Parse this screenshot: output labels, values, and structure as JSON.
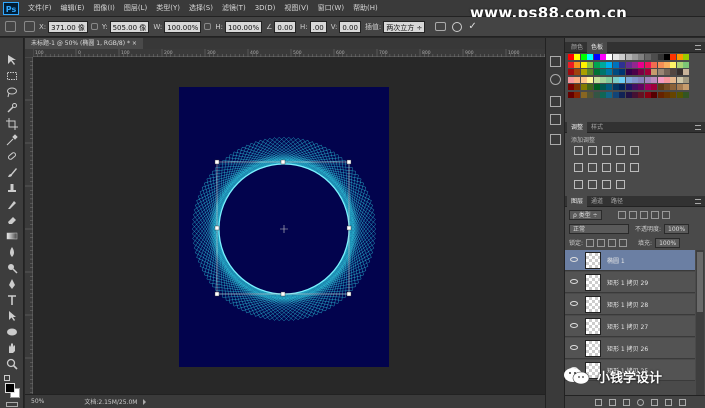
{
  "app": {
    "logo": "Ps",
    "watermark": "www.ps88.com.cn"
  },
  "menu": [
    "文件(F)",
    "编辑(E)",
    "图像(I)",
    "图层(L)",
    "类型(Y)",
    "选择(S)",
    "滤镜(T)",
    "3D(D)",
    "视图(V)",
    "窗口(W)",
    "帮助(H)"
  ],
  "options": {
    "x_label": "X:",
    "x_value": "371.00 像 ",
    "y_label": "Y:",
    "y_value": "505.00 像 ",
    "w_label": "W:",
    "w_value": "100.00%",
    "h_label": "H:",
    "h_value": "100.00%",
    "rot_label": "∠",
    "rot_value": "0.00",
    "hskew_label": "H:",
    "hskew_value": ".00",
    "vskew_label": "V:",
    "vskew_value": "0.00",
    "interp_label": "插值:",
    "interp_value": "两次立方 ÷"
  },
  "document": {
    "tab_title": "未标题-1 @ 50% (椭圆 1, RGB/8) * ×",
    "zoom": "50%",
    "doc_size": "文档:2.15M/25.0M"
  },
  "ruler_labels": [
    "100",
    "0",
    "100",
    "200",
    "300",
    "400",
    "500",
    "600",
    "700",
    "800",
    "900",
    "1000"
  ],
  "panels": {
    "color_tabs": [
      "颜色",
      "色板"
    ],
    "adjust_tabs": [
      "调整",
      "样式"
    ],
    "adjust_label": "添加调整",
    "layer_tabs": [
      "图层",
      "通道",
      "路径"
    ],
    "filter_kind": "ρ 类型 ÷",
    "blend_mode": "正常",
    "opacity_label": "不透明度:",
    "opacity_value": "100%",
    "lock_label": "锁定:",
    "fill_label": "填充:",
    "fill_value": "100%"
  },
  "layers": [
    {
      "name": "椭圆 1",
      "selected": true
    },
    {
      "name": "矩形 1 拷贝 29",
      "selected": false
    },
    {
      "name": "矩形 1 拷贝 28",
      "selected": false
    },
    {
      "name": "矩形 1 拷贝 27",
      "selected": false
    },
    {
      "name": "矩形 1 拷贝 26",
      "selected": false
    },
    {
      "name": "矩形 1 拷贝 25",
      "selected": false
    }
  ],
  "credit": {
    "text": "小钱学设计"
  },
  "colors": {
    "artboard": "#02034d",
    "line_cyan": "#2fd3e6",
    "selected_layer": "#6b7fa3"
  }
}
